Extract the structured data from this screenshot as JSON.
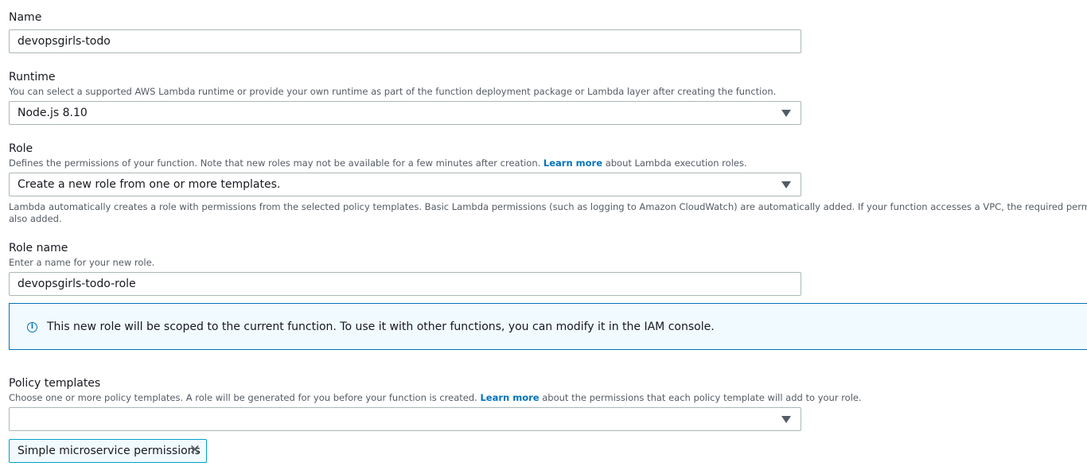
{
  "name": {
    "label": "Name",
    "value": "devopsgirls-todo"
  },
  "runtime": {
    "label": "Runtime",
    "description": "You can select a supported AWS Lambda runtime or provide your own runtime as part of the function deployment package or Lambda layer after creating the function.",
    "selected": "Node.js 8.10"
  },
  "role": {
    "label": "Role",
    "description_pre": "Defines the permissions of your function. Note that new roles may not be available for a few minutes after creation.",
    "learn_more": "Learn more",
    "description_post": "about Lambda execution roles.",
    "selected": "Create a new role from one or more templates.",
    "help_line1": "Lambda automatically creates a role with permissions from the selected policy templates. Basic Lambda permissions (such as logging to Amazon CloudWatch) are automatically added. If your function accesses a VPC, the required permissions are",
    "help_line2": "also added."
  },
  "role_name": {
    "label": "Role name",
    "description": "Enter a name for your new role.",
    "value": "devopsgirls-todo-role"
  },
  "info_alert": {
    "icon": "info-icon",
    "text": "This new role will be scoped to the current function. To use it with other functions, you can modify it in the IAM console."
  },
  "policy_templates": {
    "label": "Policy templates",
    "description_pre": "Choose one or more policy templates. A role will be generated for you before your function is created.",
    "learn_more": "Learn more",
    "description_post": "about the permissions that each policy template will add to your role.",
    "selected": "",
    "tokens": [
      "Simple microservice permissions"
    ]
  },
  "colors": {
    "accent": "#0073bb",
    "info_bg": "#f1faff",
    "token_border": "#00a1c9"
  }
}
